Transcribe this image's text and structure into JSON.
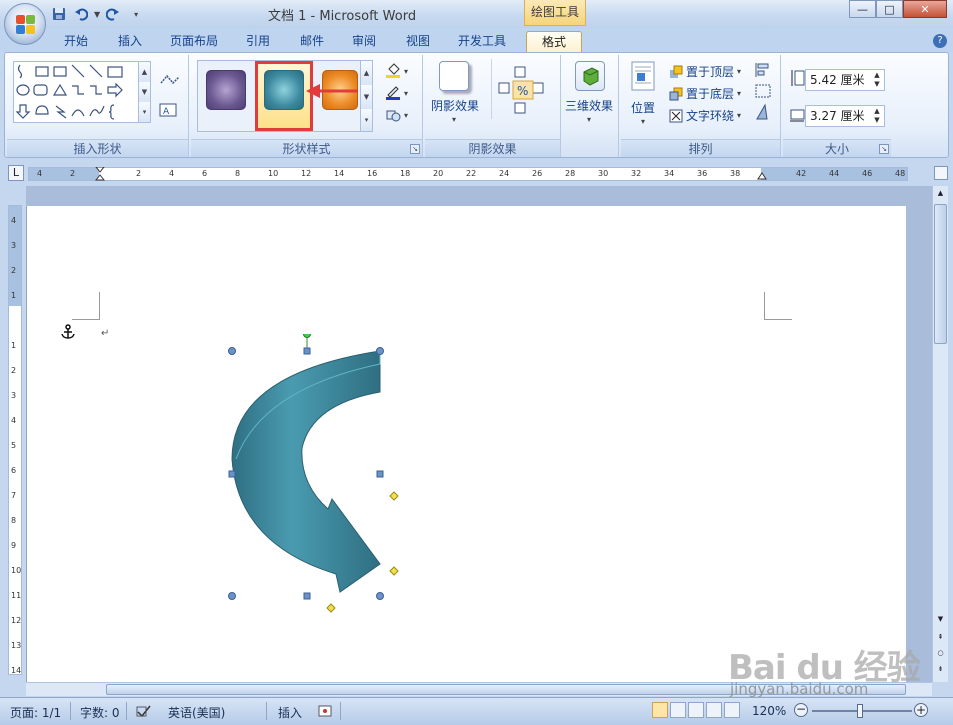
{
  "window": {
    "title": "文档 1 - Microsoft Word",
    "contextual_tab_title": "绘图工具",
    "buttons": {
      "minimize": "—",
      "maximize": "□",
      "close": "✕"
    }
  },
  "tabs": [
    {
      "label": "开始"
    },
    {
      "label": "插入"
    },
    {
      "label": "页面布局"
    },
    {
      "label": "引用"
    },
    {
      "label": "邮件"
    },
    {
      "label": "审阅"
    },
    {
      "label": "视图"
    },
    {
      "label": "开发工具"
    },
    {
      "label": "格式",
      "active": true
    }
  ],
  "help_label": "?",
  "ribbon": {
    "insert_shapes": {
      "label": "插入形状"
    },
    "shape_styles": {
      "label": "形状样式",
      "selected_style_index": 1
    },
    "shadow": {
      "label": "阴影效果",
      "button_label": "阴影效果"
    },
    "three_d": {
      "label": "三维效果"
    },
    "arrange": {
      "label": "排列",
      "position_label": "位置",
      "bring_front": "置于顶层",
      "send_back": "置于底层",
      "text_wrap": "文字环绕"
    },
    "size": {
      "label": "大小",
      "height": "5.42 厘米",
      "width": "3.27 厘米"
    }
  },
  "ruler": {
    "h_ticks": [
      "4",
      "2",
      "",
      "2",
      "4",
      "6",
      "8",
      "10",
      "12",
      "14",
      "16",
      "18",
      "20",
      "22",
      "24",
      "26",
      "28",
      "30",
      "32",
      "34",
      "36",
      "38",
      "",
      "42",
      "44",
      "46",
      "48"
    ],
    "v_ticks": [
      "4",
      "3",
      "2",
      "1",
      "",
      "1",
      "2",
      "3",
      "4",
      "5",
      "6",
      "7",
      "8",
      "9",
      "10",
      "11",
      "12",
      "13",
      "14"
    ]
  },
  "colors": {
    "arrow_shape": "#3d8aa0",
    "accent_red": "#e23b3b",
    "ribbon_blue": "#15428b"
  },
  "statusbar": {
    "page": "页面: 1/1",
    "words": "字数: 0",
    "language": "英语(美国)",
    "mode": "插入",
    "zoom": "120%"
  },
  "watermark": {
    "brand": "Bai du 经验",
    "url": "jingyan.baidu.com"
  }
}
